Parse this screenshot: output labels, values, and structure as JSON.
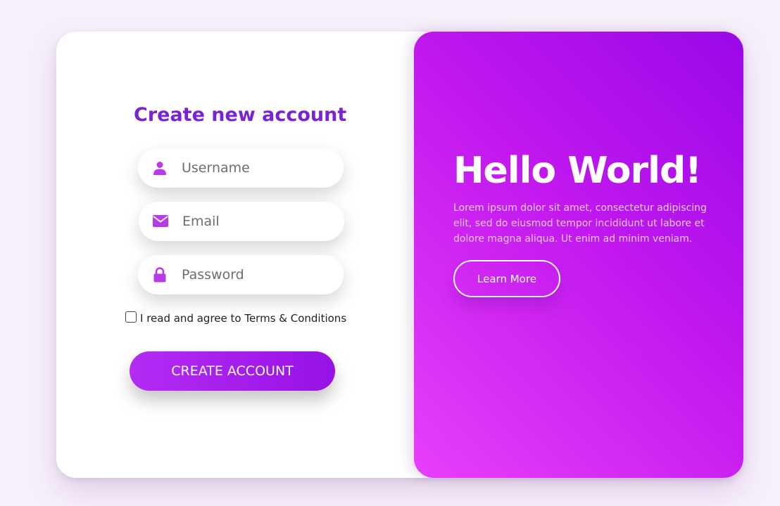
{
  "signup": {
    "title": "Create new account",
    "username": {
      "placeholder": "Username",
      "icon": "user-icon"
    },
    "email": {
      "placeholder": "Email",
      "icon": "envelope-icon"
    },
    "password": {
      "placeholder": "Password",
      "icon": "lock-icon"
    },
    "terms_label": "I read and agree to Terms & Conditions",
    "terms_checked": false,
    "submit_label": "CREATE ACCOUNT"
  },
  "promo": {
    "heading": "Hello World!",
    "body": "Lorem ipsum dolor sit amet, consectetur adipiscing elit, sed do eiusmod tempor incididunt ut labore et dolore magna aliqua. Ut enim ad minim veniam.",
    "button_label": "Learn More"
  },
  "colors": {
    "accent": "#7a22d4",
    "icon": "#b83ae8",
    "gradient_start": "#9a08e8",
    "gradient_end": "#e83ffb",
    "background": "#f7f0fb"
  }
}
